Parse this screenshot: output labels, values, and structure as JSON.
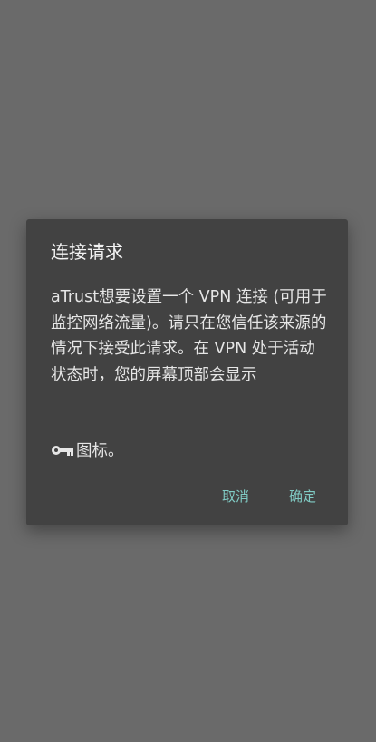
{
  "dialog": {
    "title": "连接请求",
    "message": "aTrust想要设置一个 VPN 连接 (可用于监控网络流量)。请只在您信任该来源的情况下接受此请求。在 VPN 处于活动状态时，您的屏幕顶部会显示",
    "icon_line_suffix": "图标。",
    "icon_name": "key-icon",
    "cancel_label": "取消",
    "ok_label": "确定",
    "accent_color": "#80cbc4"
  }
}
